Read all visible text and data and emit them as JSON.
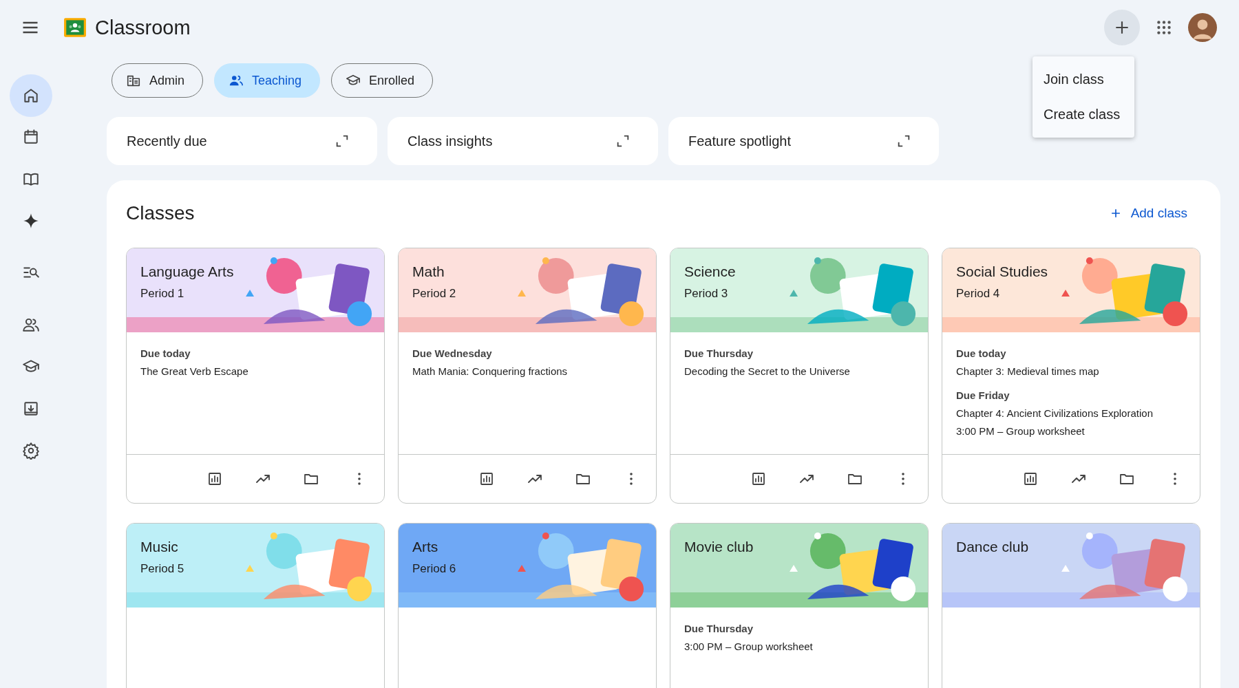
{
  "app": {
    "title": "Classroom"
  },
  "menu": {
    "items": [
      {
        "label": "Join class"
      },
      {
        "label": "Create class"
      }
    ]
  },
  "sidebar": {
    "items": [
      {
        "selected": true
      },
      {
        "selected": false
      },
      {
        "selected": false
      },
      {
        "selected": false
      },
      {
        "selected": false
      },
      {
        "selected": false
      },
      {
        "selected": false
      },
      {
        "selected": false
      },
      {
        "selected": false
      }
    ]
  },
  "filters": [
    {
      "label": "Admin",
      "selected": false
    },
    {
      "label": "Teaching",
      "selected": true
    },
    {
      "label": "Enrolled",
      "selected": false
    }
  ],
  "summary_cards": [
    {
      "title": "Recently due"
    },
    {
      "title": "Class insights"
    },
    {
      "title": "Feature spotlight"
    }
  ],
  "classes": {
    "title": "Classes",
    "add_label": "Add class",
    "cards": [
      {
        "name": "Language Arts",
        "period": "Period 1",
        "assignments": [
          {
            "due": "Due today",
            "items": [
              "The Great Verb Escape"
            ]
          }
        ]
      },
      {
        "name": "Math",
        "period": "Period 2",
        "assignments": [
          {
            "due": "Due Wednesday",
            "items": [
              "Math Mania: Conquering fractions"
            ]
          }
        ]
      },
      {
        "name": "Science",
        "period": "Period 3",
        "assignments": [
          {
            "due": "Due Thursday",
            "items": [
              "Decoding the Secret to the Universe"
            ]
          }
        ]
      },
      {
        "name": "Social Studies",
        "period": "Period 4",
        "assignments": [
          {
            "due": "Due today",
            "items": [
              "Chapter 3: Medieval times map"
            ]
          },
          {
            "due": "Due Friday",
            "items": [
              "Chapter 4: Ancient Civilizations Exploration",
              "3:00 PM – Group worksheet"
            ]
          }
        ]
      },
      {
        "name": "Music",
        "period": "Period 5"
      },
      {
        "name": "Arts",
        "period": "Period 6"
      },
      {
        "name": "Movie club",
        "assignments": [
          {
            "due": "Due Thursday",
            "items": [
              "3:00 PM – Group worksheet"
            ]
          }
        ]
      },
      {
        "name": "Dance club"
      }
    ]
  }
}
